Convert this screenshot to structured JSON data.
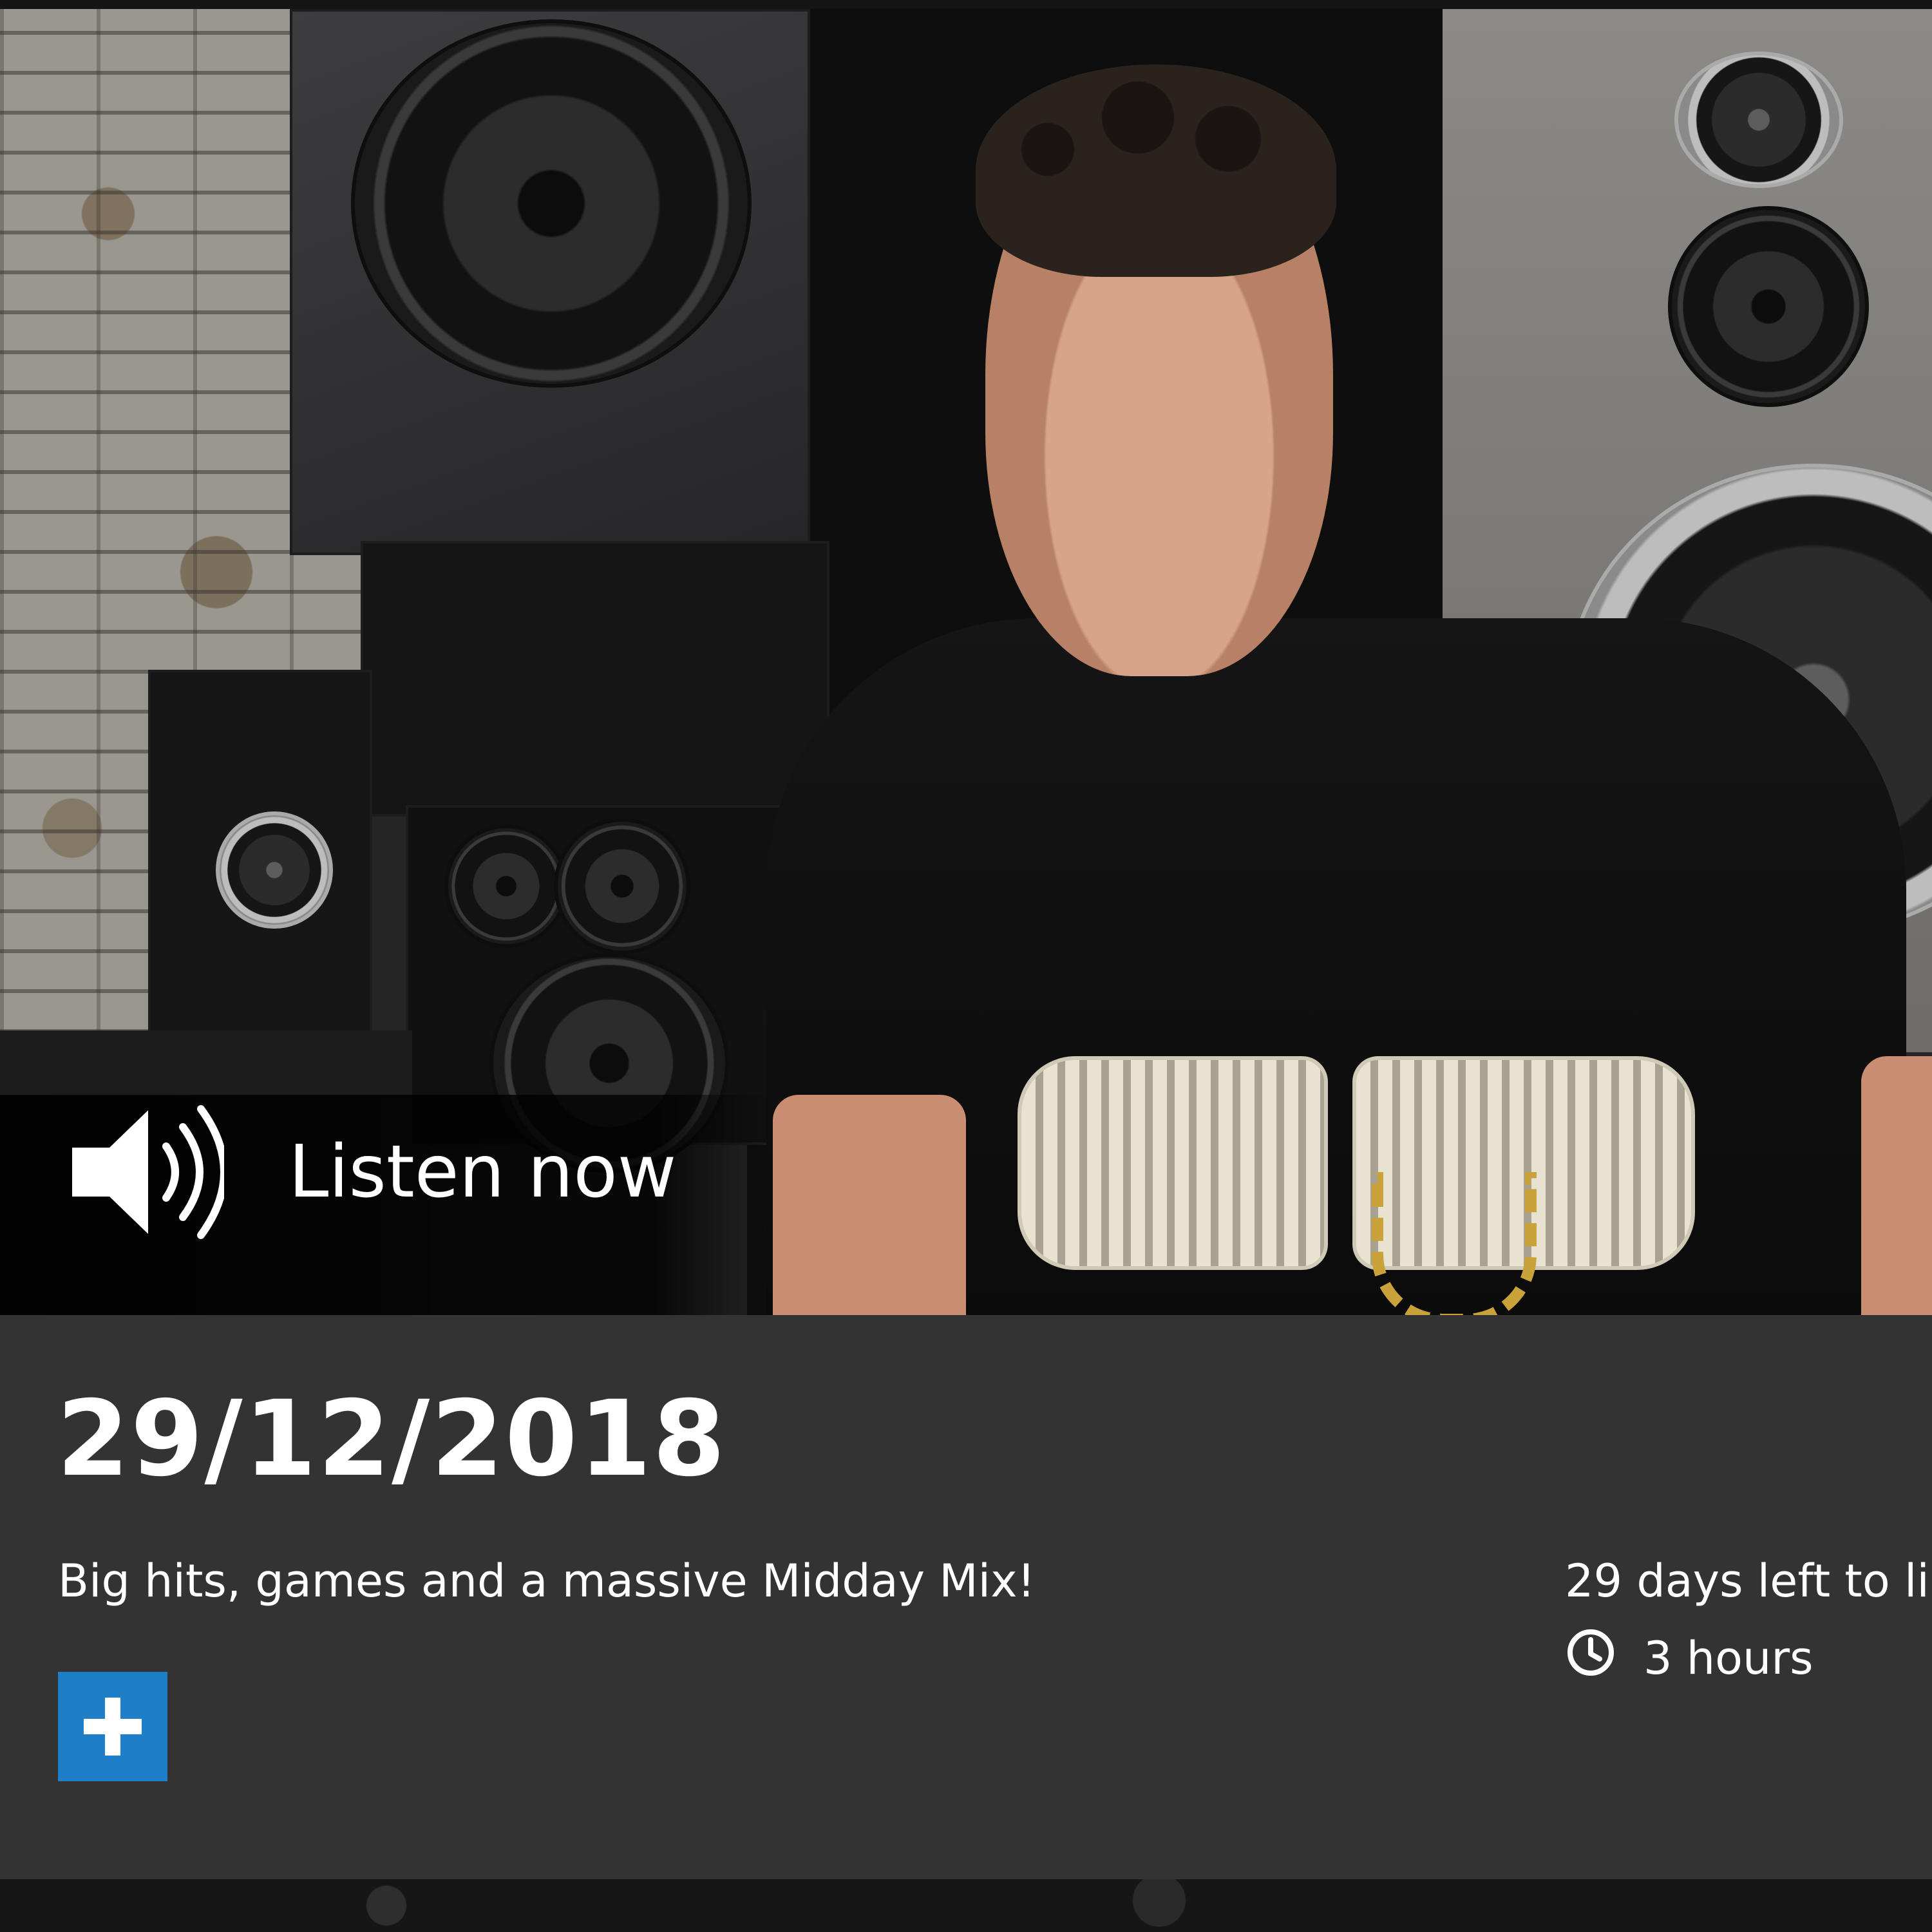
{
  "hero": {
    "listen_label": "Listen now",
    "speaker_icon": "speaker-volume-icon"
  },
  "episode": {
    "date": "29/12/2018",
    "description": "Big hits, games and a massive Midday Mix!",
    "availability": "29 days left to li",
    "duration": "3 hours",
    "duration_icon": "clock-icon"
  },
  "actions": {
    "add_icon": "plus-icon"
  },
  "colors": {
    "panel_background": "#333333",
    "add_button": "#1e7ec8",
    "text": "#ffffff"
  }
}
